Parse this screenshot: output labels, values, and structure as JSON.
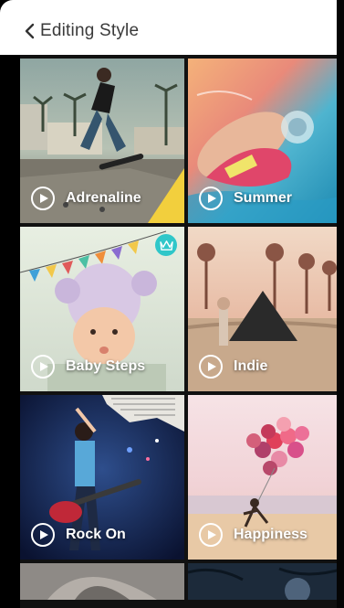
{
  "header": {
    "title": "Editing Style"
  },
  "tiles": [
    {
      "label": "Adrenaline"
    },
    {
      "label": "Summer"
    },
    {
      "label": "Baby Steps"
    },
    {
      "label": "Indie"
    },
    {
      "label": "Rock On"
    },
    {
      "label": "Happiness"
    }
  ],
  "colors": {
    "premium_badge": "#2fc7c9",
    "header_bg": "#ffffff",
    "title_text": "#3a3a3a"
  },
  "icons": {
    "back": "chevron-left-icon",
    "play": "play-icon",
    "premium": "crown-icon"
  }
}
